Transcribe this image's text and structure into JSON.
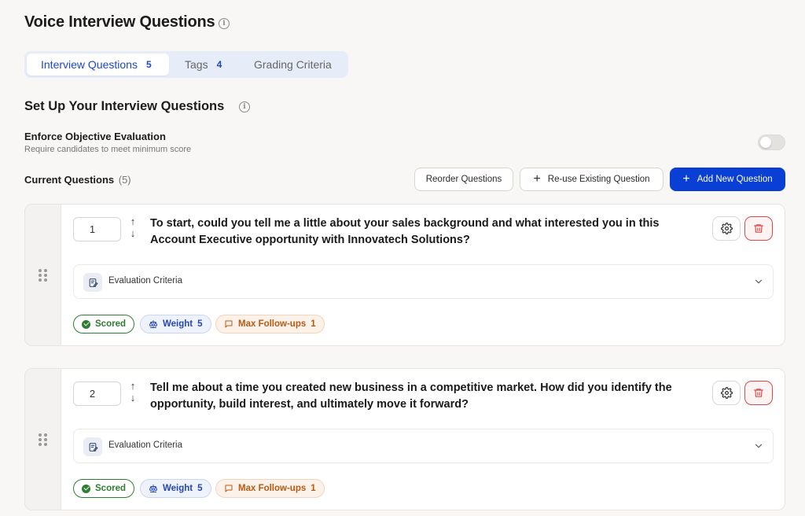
{
  "header": {
    "title": "Voice Interview Questions"
  },
  "tabs": [
    {
      "label": "Interview Questions",
      "count": "5",
      "active": true
    },
    {
      "label": "Tags",
      "count": "4",
      "active": false
    },
    {
      "label": "Grading Criteria",
      "count": "",
      "active": false
    }
  ],
  "setup": {
    "title": "Set Up Your Interview Questions",
    "enforce_title": "Enforce Objective Evaluation",
    "enforce_subtitle": "Require candidates to meet minimum score",
    "enforce_enabled": false
  },
  "current": {
    "label": "Current Questions",
    "count": "(5)"
  },
  "actions": {
    "reorder": "Reorder Questions",
    "reuse": "Re-use Existing Question",
    "add": "Add New Question"
  },
  "questions": [
    {
      "number": "1",
      "text": "To start, could you tell me a little about your sales background and what interested you in this Account Executive opportunity with Innovatech Solutions?",
      "eval_label": "Evaluation Criteria",
      "scored_label": "Scored",
      "weight_label": "Weight",
      "weight_value": "5",
      "followups_label": "Max Follow-ups",
      "followups_value": "1"
    },
    {
      "number": "2",
      "text": "Tell me about a time you created new business in a competitive market. How did you identify the opportunity, build interest, and ultimately move it forward?",
      "eval_label": "Evaluation Criteria",
      "scored_label": "Scored",
      "weight_label": "Weight",
      "weight_value": "5",
      "followups_label": "Max Follow-ups",
      "followups_value": "1"
    }
  ],
  "colors": {
    "accent": "#0a3fd6",
    "tab_bg": "#e6ecf8",
    "scored": "#2e7d32",
    "weight": "#2447b5",
    "followups": "#b85a12",
    "delete": "#d94a4a"
  },
  "icons": {
    "title_info": "info-icon",
    "settings": "gear-icon",
    "delete": "trash-icon",
    "eval": "edit-note-icon",
    "expand": "chevron-down-icon",
    "drag": "drag-handle-icon",
    "weight": "scale-icon",
    "followups": "chat-bubble-icon"
  }
}
